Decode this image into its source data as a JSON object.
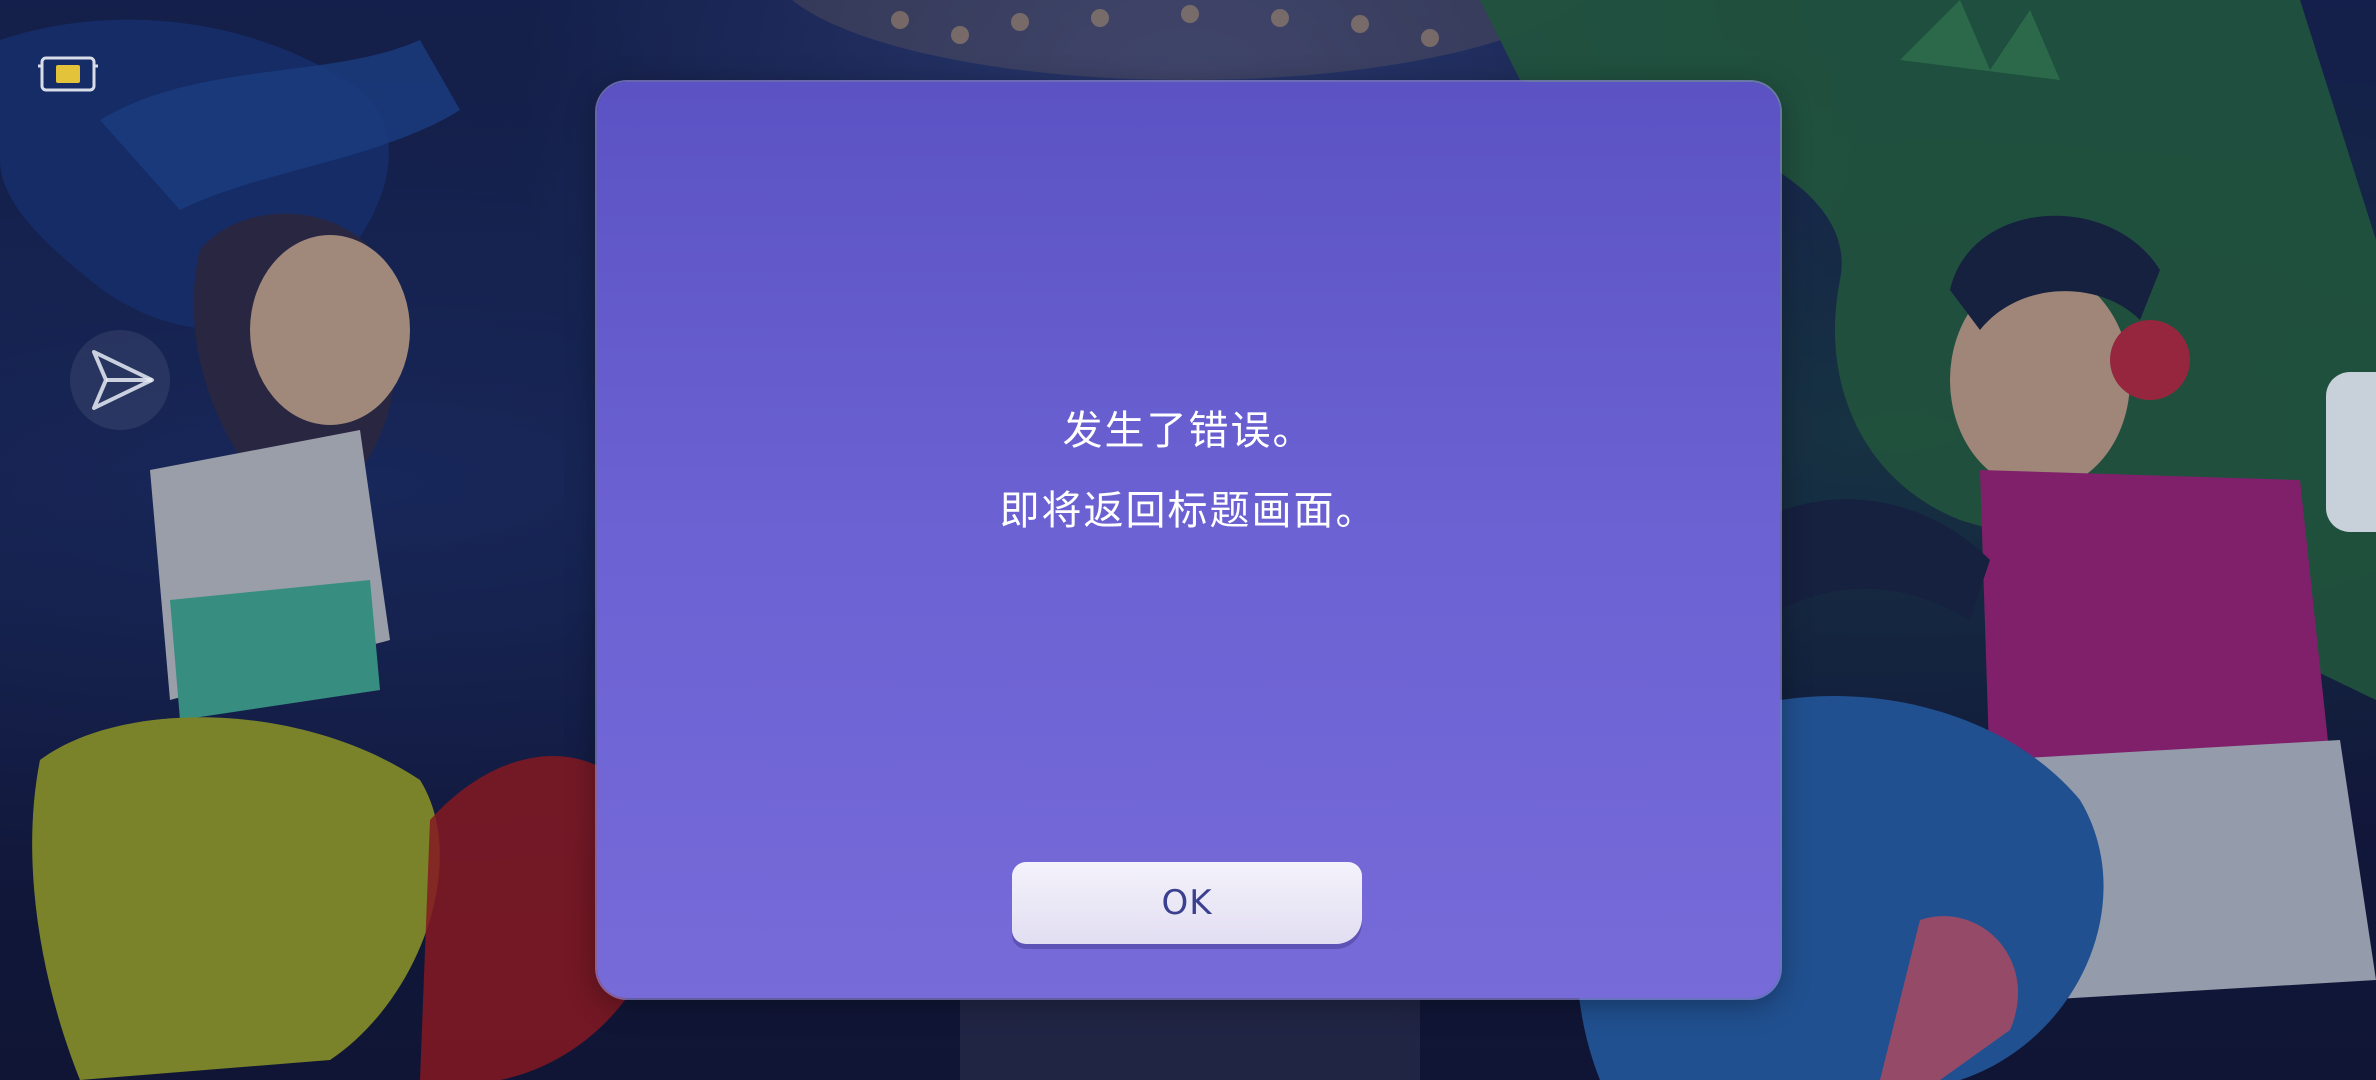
{
  "background": {
    "description_icon": "game-key-art",
    "left_character_icon": "trainer-girl-icon",
    "right_character_icon": "trainer-boy-icon"
  },
  "hud": {
    "corner_icon": "screen-record-icon",
    "side_icon": "send-arrow-icon",
    "edge_tab_icon": "side-tab-icon"
  },
  "dialog": {
    "message_line1": "发生了错误。",
    "message_line2": "即将返回标题画面。",
    "ok_label": "OK"
  },
  "colors": {
    "dialog_top": "#5b52c4",
    "dialog_bottom": "#776ad9",
    "button_text": "#3b3f8f"
  }
}
